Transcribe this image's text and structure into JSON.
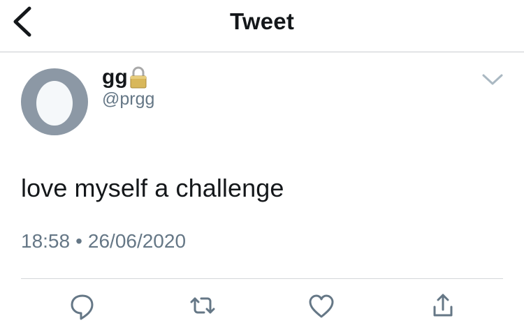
{
  "nav": {
    "title": "Tweet"
  },
  "author": {
    "display_name": "gg",
    "handle": "@prgg",
    "protected_icon": "lock-icon",
    "avatar": "default-egg-avatar"
  },
  "tweet": {
    "text": "love myself a challenge",
    "time": "18:58",
    "separator": "•",
    "date": "26/06/2020"
  },
  "actions": [
    "reply-icon",
    "retweet-icon",
    "like-icon",
    "share-icon"
  ],
  "colors": {
    "text": "#14171a",
    "secondary": "#657786",
    "avatar_bg": "#8c98a5",
    "icon": "#657786"
  }
}
